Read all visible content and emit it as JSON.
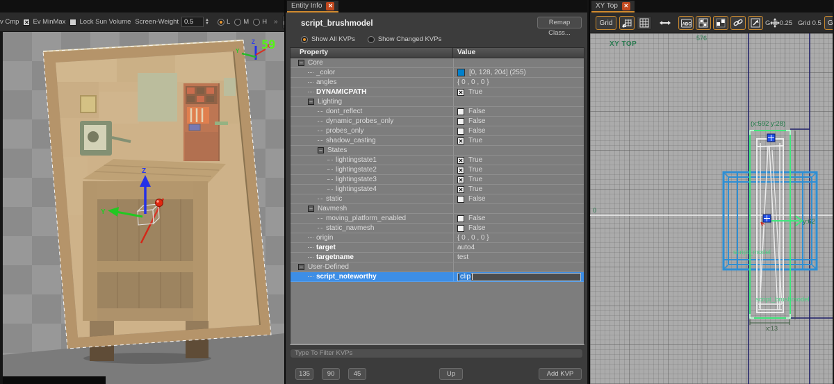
{
  "left_toolbar": {
    "overflow_label": "v Cmp",
    "ev_minmax": "Ev MinMax",
    "ev_minmax_checked": true,
    "lock_sun_volume": "Lock Sun Volume",
    "lock_sun_checked": false,
    "screen_weight_label": "Screen-Weight",
    "screen_weight_value": "0.5",
    "radio_low": "L",
    "radio_med": "M",
    "radio_high": "H",
    "radio_selected": "L",
    "chevron": "»"
  },
  "viewport3d": {
    "fps": "59",
    "axis_z": "Z",
    "axis_y": "Y",
    "axis_x": "X"
  },
  "entity_panel": {
    "tab": "Entity Info",
    "title": "script_brushmodel",
    "remap_button": "Remap Class...",
    "radio_show_all": "Show All KVPs",
    "radio_show_changed": "Show Changed KVPs",
    "radio_selected": "Show All KVPs",
    "table": {
      "property_header": "Property",
      "value_header": "Value",
      "rows": [
        {
          "label": "Core",
          "type": "category",
          "level": 0
        },
        {
          "label": "_color",
          "type": "color",
          "level": 1,
          "value": "[0, 128, 204] (255)",
          "swatch": "#0080cc"
        },
        {
          "label": "angles",
          "type": "text",
          "level": 1,
          "value": "{ 0 , 0 , 0 }"
        },
        {
          "label": "DYNAMICPATH",
          "type": "check",
          "level": 1,
          "checked": true,
          "value": "True",
          "bold": true
        },
        {
          "label": "Lighting",
          "type": "category",
          "level": 1
        },
        {
          "label": "dont_reflect",
          "type": "check",
          "level": 2,
          "checked": false,
          "value": "False"
        },
        {
          "label": "dynamic_probes_only",
          "type": "check",
          "level": 2,
          "checked": false,
          "value": "False"
        },
        {
          "label": "probes_only",
          "type": "check",
          "level": 2,
          "checked": false,
          "value": "False"
        },
        {
          "label": "shadow_casting",
          "type": "check",
          "level": 2,
          "checked": true,
          "value": "True"
        },
        {
          "label": "States",
          "type": "category",
          "level": 2
        },
        {
          "label": "lightingstate1",
          "type": "check",
          "level": 3,
          "checked": true,
          "value": "True"
        },
        {
          "label": "lightingstate2",
          "type": "check",
          "level": 3,
          "checked": true,
          "value": "True"
        },
        {
          "label": "lightingstate3",
          "type": "check",
          "level": 3,
          "checked": true,
          "value": "True"
        },
        {
          "label": "lightingstate4",
          "type": "check",
          "level": 3,
          "checked": true,
          "value": "True"
        },
        {
          "label": "static",
          "type": "check",
          "level": 2,
          "checked": false,
          "value": "False"
        },
        {
          "label": "Navmesh",
          "type": "category",
          "level": 1
        },
        {
          "label": "moving_platform_enabled",
          "type": "check",
          "level": 2,
          "checked": false,
          "value": "False"
        },
        {
          "label": "static_navmesh",
          "type": "check",
          "level": 2,
          "checked": false,
          "value": "False"
        },
        {
          "label": "origin",
          "type": "text",
          "level": 1,
          "value": "{ 0 , 0 , 0 }"
        },
        {
          "label": "target",
          "type": "text",
          "level": 1,
          "value": "auto4",
          "bold": true
        },
        {
          "label": "targetname",
          "type": "text",
          "level": 1,
          "value": "test",
          "bold": true
        },
        {
          "label": "User-Defined",
          "type": "category",
          "level": 0
        },
        {
          "label": "script_noteworthy",
          "type": "edit",
          "level": 1,
          "value": "clip",
          "selected": true,
          "bold": true
        }
      ]
    },
    "filter_placeholder": "Type To Filter KVPs",
    "buttons": {
      "b135": "135",
      "b90": "90",
      "b45": "45",
      "up": "Up",
      "add_kvp": "Add KVP"
    }
  },
  "viewport2d": {
    "tab": "XY Top",
    "toolbar": {
      "grid_button": "Grid",
      "abc_icon_text": "ABC",
      "grid_quarter": "Grid 0.25",
      "grid_half": "Grid 0.5",
      "grid_cut": "Grid"
    },
    "labels": {
      "view_name": "XY TOP",
      "grid_coord": "576",
      "origin": "0",
      "cursor": "(x:592  y:28)",
      "y_measure": "y:62",
      "x_measure": "x:13",
      "model_name": "script_model",
      "brush_name": "script_brushmodel"
    }
  },
  "colors": {
    "accent_orange": "#d08a2e",
    "selection_blue": "#3d8ee6",
    "entity_color_swatch": "#0080cc",
    "wire_blue": "#2e8fd4",
    "selection_green": "#3fe87c",
    "navy_line": "#1d1d66",
    "label_green": "#1f7a46",
    "fps_green": "#55f515"
  }
}
